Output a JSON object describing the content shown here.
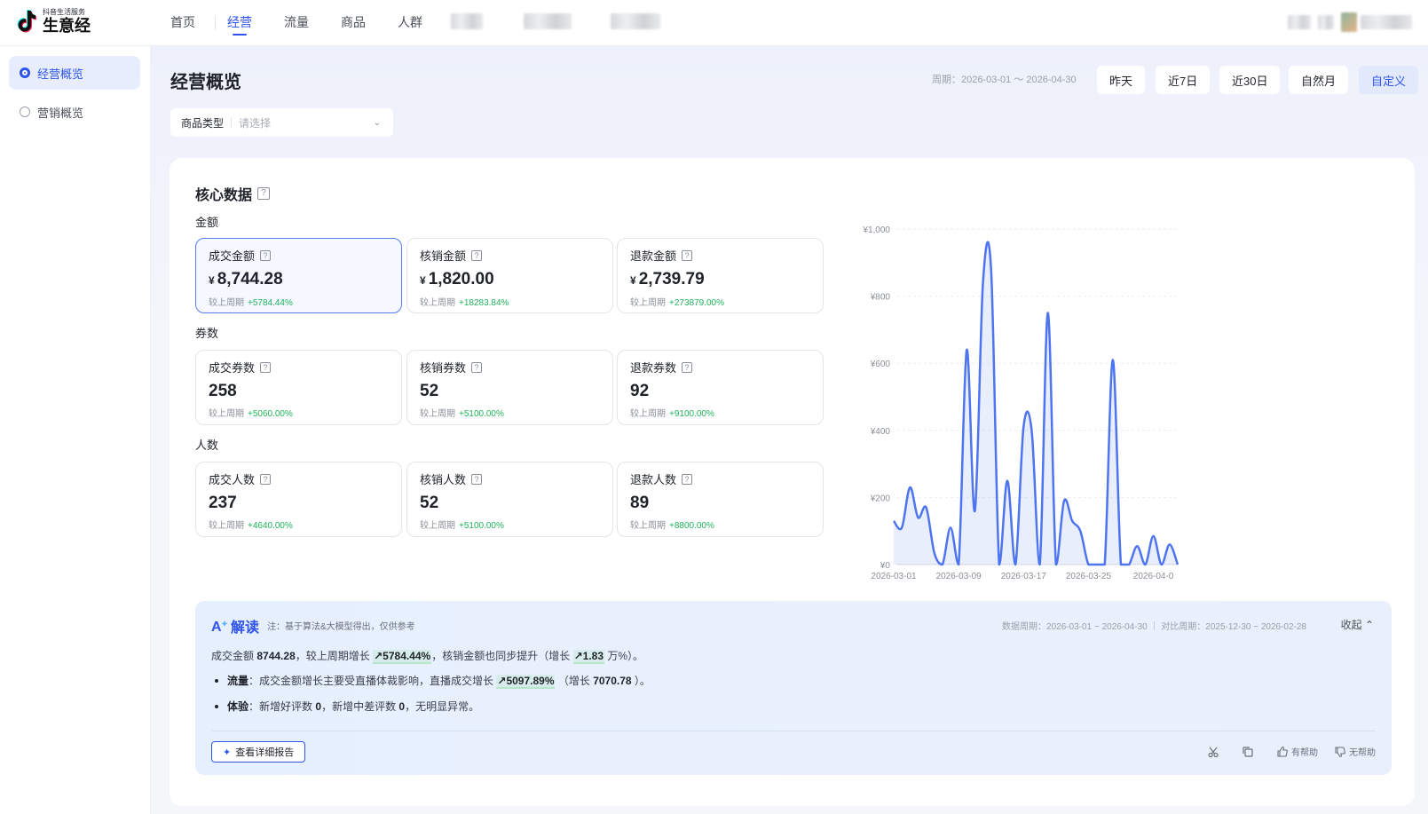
{
  "brand": {
    "sub": "抖音生活服务",
    "main": "生意经"
  },
  "nav": {
    "items": [
      {
        "label": "首页"
      },
      {
        "label": "经营"
      },
      {
        "label": "流量"
      },
      {
        "label": "商品"
      },
      {
        "label": "人群"
      }
    ]
  },
  "sidebar": {
    "items": [
      {
        "label": "经营概览"
      },
      {
        "label": "营销概览"
      }
    ]
  },
  "page": {
    "title": "经营概览"
  },
  "date_range": {
    "period": "周期：2026-03-01 ～ 2026-04-30",
    "buttons": [
      {
        "label": "昨天"
      },
      {
        "label": "近7日"
      },
      {
        "label": "近30日"
      },
      {
        "label": "自然月"
      },
      {
        "label": "自定义"
      }
    ]
  },
  "filter": {
    "label": "商品类型",
    "placeholder": "请选择"
  },
  "core": {
    "title": "核心数据",
    "compare_label": "较上周期",
    "sections": [
      {
        "label": "金额",
        "metrics": [
          {
            "label": "成交金额",
            "currency": "¥",
            "value": "8,744.28",
            "change": "+5784.44%"
          },
          {
            "label": "核销金额",
            "currency": "¥",
            "value": "1,820.00",
            "change": "+18283.84%"
          },
          {
            "label": "退款金额",
            "currency": "¥",
            "value": "2,739.79",
            "change": "+273879.00%"
          }
        ]
      },
      {
        "label": "券数",
        "metrics": [
          {
            "label": "成交券数",
            "value": "258",
            "change": "+5060.00%"
          },
          {
            "label": "核销券数",
            "value": "52",
            "change": "+5100.00%"
          },
          {
            "label": "退款券数",
            "value": "92",
            "change": "+9100.00%"
          }
        ]
      },
      {
        "label": "人数",
        "metrics": [
          {
            "label": "成交人数",
            "value": "237",
            "change": "+4640.00%"
          },
          {
            "label": "核销人数",
            "value": "52",
            "change": "+5100.00%"
          },
          {
            "label": "退款人数",
            "value": "89",
            "change": "+8800.00%"
          }
        ]
      }
    ]
  },
  "chart_data": {
    "type": "area",
    "title": "",
    "xlabel": "",
    "ylabel": "",
    "y_ticks": [
      "¥0",
      "¥200",
      "¥400",
      "¥600",
      "¥800",
      "¥1,000"
    ],
    "ylim": [
      0,
      1000
    ],
    "x_ticks": [
      "2026-03-01",
      "2026-03-09",
      "2026-03-17",
      "2026-03-25",
      "2026-04-0"
    ],
    "x_tick_days": [
      0,
      8,
      16,
      24,
      32
    ],
    "x": [
      0,
      1,
      2,
      3,
      4,
      5,
      6,
      7,
      8,
      9,
      10,
      11,
      12,
      13,
      14,
      15,
      16,
      17,
      18,
      19,
      20,
      21,
      22,
      23,
      24,
      25,
      26,
      27,
      28,
      29,
      30,
      31,
      32,
      33,
      34,
      35
    ],
    "values": [
      130,
      110,
      230,
      140,
      170,
      35,
      0,
      110,
      0,
      640,
      160,
      840,
      880,
      0,
      250,
      0,
      410,
      400,
      0,
      750,
      0,
      190,
      130,
      100,
      0,
      0,
      0,
      610,
      0,
      0,
      55,
      0,
      85,
      0,
      60,
      0
    ],
    "series": [
      {
        "name": "",
        "color": "#4e74f0"
      }
    ],
    "grid": true
  },
  "ai": {
    "title": "解读",
    "note": "注：基于算法&大模型得出，仅供参考",
    "period": "数据周期：2026-03-01 ~ 2026-04-30  ｜  对比周期：2025-12-30 ~ 2026-02-28",
    "collapse": "收起",
    "line1": {
      "a": "成交金额",
      "b": "8744.28",
      "c": "，较上周期增长",
      "d": "5784.44%",
      "e": "，核销金额也同步提升（增长",
      "f": "1.83",
      "g": "万%）。"
    },
    "line2": {
      "key": "流量",
      "a": "：成交金额增长主要受直播体裁影响，直播成交增长",
      "b": "5097.89%",
      "c": "（增长",
      "d": "7070.78",
      "e": "）。"
    },
    "line3": {
      "key": "体验",
      "a": "：新增好评数",
      "b": "0",
      "c": "，新增中差评数",
      "d": "0",
      "e": "，无明显异常。"
    },
    "detail_button": "查看详细报告",
    "helpful": "有帮助",
    "not_helpful": "无帮助"
  }
}
